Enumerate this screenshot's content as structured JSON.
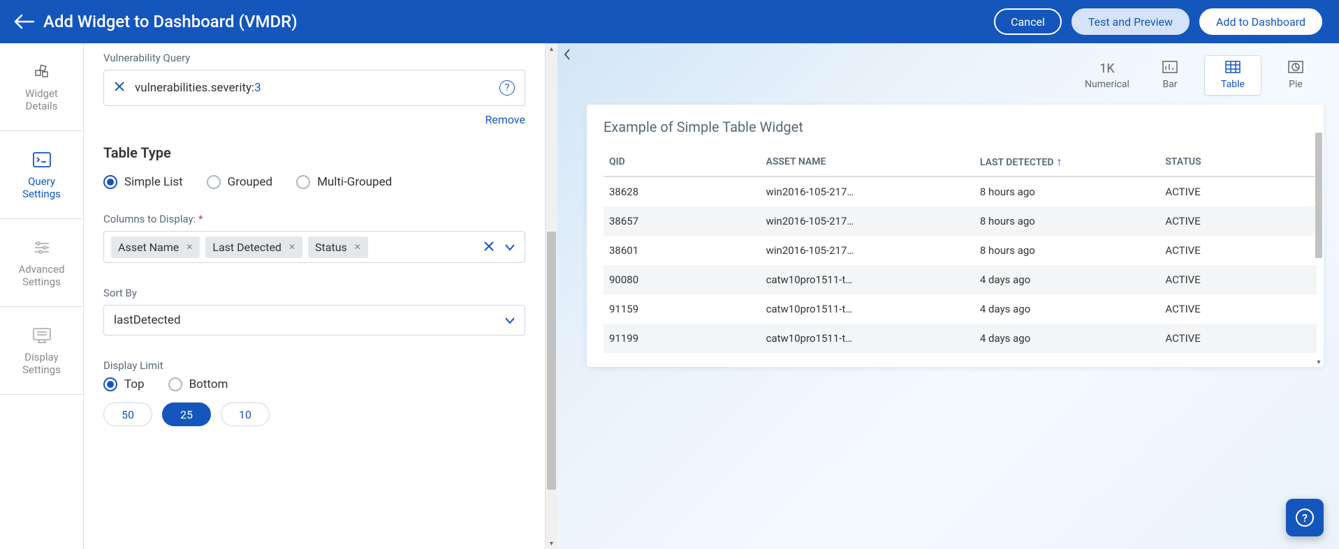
{
  "header": {
    "title": "Add Widget to Dashboard (VMDR)",
    "buttons": {
      "cancel": "Cancel",
      "test": "Test and Preview",
      "add": "Add to Dashboard"
    }
  },
  "left_nav": [
    {
      "label": "Widget\nDetails"
    },
    {
      "label": "Query\nSettings"
    },
    {
      "label": "Advanced\nSettings"
    },
    {
      "label": "Display\nSettings"
    }
  ],
  "form": {
    "query_label": "Vulnerability Query",
    "query_text": "vulnerabilities.severity:",
    "query_value": "3",
    "remove": "Remove",
    "table_type_title": "Table Type",
    "table_type_options": [
      "Simple List",
      "Grouped",
      "Multi-Grouped"
    ],
    "table_type_selected": "Simple List",
    "columns_label": "Columns to Display:",
    "columns_required": "*",
    "columns_chips": [
      "Asset Name",
      "Last Detected",
      "Status"
    ],
    "sort_by_label": "Sort By",
    "sort_by_value": "lastDetected",
    "display_limit_label": "Display Limit",
    "display_limit_options": [
      "Top",
      "Bottom"
    ],
    "display_limit_selected": "Top",
    "display_limit_pills": [
      "50",
      "25",
      "10"
    ],
    "display_limit_pill_selected": "25"
  },
  "preview": {
    "view_tabs": [
      {
        "key": "numerical",
        "label": "Numerical",
        "big": "1K"
      },
      {
        "key": "bar",
        "label": "Bar"
      },
      {
        "key": "table",
        "label": "Table"
      },
      {
        "key": "pie",
        "label": "Pie"
      }
    ],
    "view_selected": "table",
    "card_title": "Example of Simple Table Widget",
    "columns": [
      "QID",
      "ASSET NAME",
      "LAST DETECTED",
      "STATUS"
    ],
    "sort_column": "LAST DETECTED",
    "rows": [
      {
        "qid": "38628",
        "asset": "win2016-105-217…",
        "detected": "8 hours ago",
        "status": "ACTIVE"
      },
      {
        "qid": "38657",
        "asset": "win2016-105-217…",
        "detected": "8 hours ago",
        "status": "ACTIVE"
      },
      {
        "qid": "38601",
        "asset": "win2016-105-217…",
        "detected": "8 hours ago",
        "status": "ACTIVE"
      },
      {
        "qid": "90080",
        "asset": "catw10pro1511-t…",
        "detected": "4 days ago",
        "status": "ACTIVE"
      },
      {
        "qid": "91159",
        "asset": "catw10pro1511-t…",
        "detected": "4 days ago",
        "status": "ACTIVE"
      },
      {
        "qid": "91199",
        "asset": "catw10pro1511-t…",
        "detected": "4 days ago",
        "status": "ACTIVE"
      }
    ]
  }
}
